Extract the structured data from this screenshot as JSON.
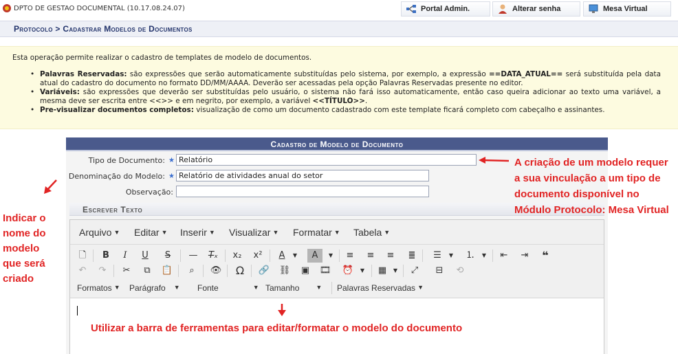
{
  "topbar": {
    "unit": "DPTO DE GESTAO DOCUMENTAL (10.17.08.24.07)",
    "buttons": [
      {
        "label": "Portal Admin.",
        "icon": "portal-icon"
      },
      {
        "label": "Alterar senha",
        "icon": "user-key-icon"
      },
      {
        "label": "Mesa Virtual",
        "icon": "desk-icon"
      }
    ]
  },
  "breadcrumb": "Protocolo > Cadastrar Modelos de Documentos",
  "info": {
    "intro": "Esta operação permite realizar o cadastro de templates de modelo de documentos.",
    "bullets": [
      {
        "term": "Palavras Reservadas:",
        "text": " são expressões que serão automaticamente substituídas pelo sistema, por exemplo, a expressão ",
        "code": "==DATA_ATUAL==",
        "rest": " será substituída pela data atual do cadastro do documento no formato DD/MM/AAAA. Deverão ser acessadas pela opção Palavras Reservadas presente no editor."
      },
      {
        "term": "Variáveis:",
        "text": " são expressões que deverão ser substituídas pelo usuário, o sistema não fará isso automaticamente, então caso queira adicionar ao texto uma variável, a mesma deve ser escrita entre <<>> e em negrito, por exemplo, a variável ",
        "code": "<<TÍTULO>>",
        "rest": "."
      },
      {
        "term": "Pre-visualizar documentos completos:",
        "text": " visualização de como um documento cadastrado com este template ficará completo com cabeçalho e assinantes.",
        "code": "",
        "rest": ""
      }
    ]
  },
  "form": {
    "title": "Cadastro de Modelo de Documento",
    "fields": {
      "tipo": {
        "label": "Tipo de Documento:",
        "value": "Relatório",
        "required": true
      },
      "denominacao": {
        "label": "Denominação do Modelo:",
        "value": "Relatório de atividades anual do setor",
        "required": true
      },
      "observacao": {
        "label": "Observação:",
        "value": "",
        "required": false
      }
    },
    "escrever_texto": "Escrever Texto"
  },
  "editor": {
    "menus": [
      "Arquivo",
      "Editar",
      "Inserir",
      "Visualizar",
      "Formatar",
      "Tabela"
    ],
    "selects": [
      "Formatos",
      "Parágrafo",
      "Fonte",
      "Tamanho",
      "Palavras Reservadas"
    ],
    "content": ""
  },
  "annotations": {
    "left": "Indicar o nome do modelo que será criado",
    "right": "A criação de um modelo requer a sua vinculação a um tipo de documento disponível no Módulo Protocolo: Mesa Virtual",
    "editor": "Utilizar a barra de ferramentas para editar/formatar o modelo do documento"
  },
  "colors": {
    "header_bg": "#4a5a8c",
    "info_bg": "#fdfbe0",
    "annotation": "#e12424",
    "breadcrumb": "#22336b"
  }
}
